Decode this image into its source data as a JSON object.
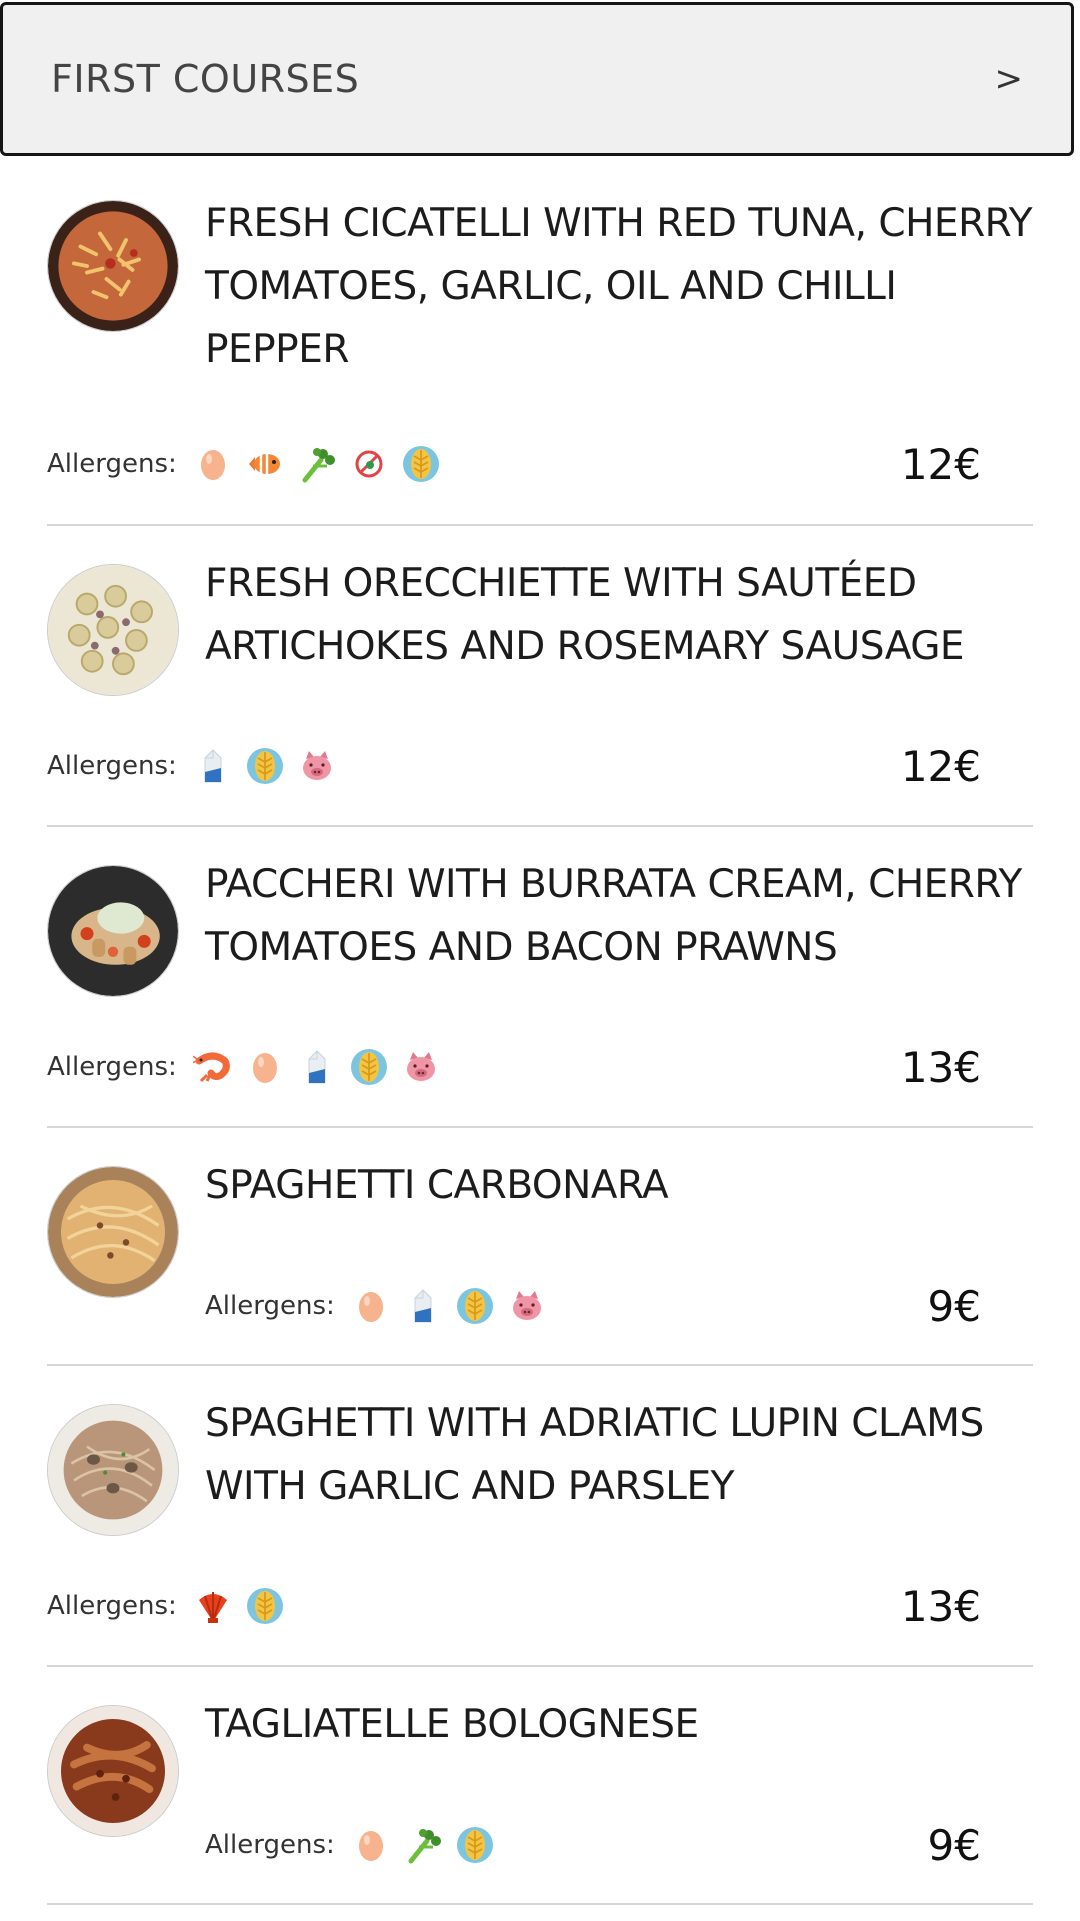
{
  "category": {
    "title": "FIRST COURSES",
    "chevron": ">"
  },
  "allergen_label": "Allergens:",
  "dishes": [
    {
      "name": "FRESH CICATELLI WITH RED TUNA, CHERRY TOMATOES, GARLIC, OIL AND CHILLI PEPPER",
      "price": "12€",
      "allergens": [
        "egg-icon",
        "fish-icon",
        "celery-icon",
        "no-sulfites-icon",
        "gluten-icon"
      ],
      "photo": "pasta-tomato"
    },
    {
      "name": "FRESH ORECCHIETTE WITH SAUTÉED ARTICHOKES AND ROSEMARY SAUSAGE",
      "price": "12€",
      "allergens": [
        "milk-icon",
        "gluten-icon",
        "pork-icon"
      ],
      "photo": "orecchiette"
    },
    {
      "name": "PACCHERI WITH BURRATA CREAM, CHERRY TOMATOES AND BACON PRAWNS",
      "price": "13€",
      "allergens": [
        "shrimp-icon",
        "egg-icon",
        "milk-icon",
        "gluten-icon",
        "pork-icon"
      ],
      "photo": "paccheri"
    },
    {
      "name": "SPAGHETTI CARBONARA",
      "price": "9€",
      "allergens": [
        "egg-icon",
        "milk-icon",
        "gluten-icon",
        "pork-icon"
      ],
      "photo": "carbonara"
    },
    {
      "name": "SPAGHETTI WITH ADRIATIC LUPIN CLAMS WITH GARLIC AND PARSLEY",
      "price": "13€",
      "allergens": [
        "shellfish-icon",
        "gluten-icon"
      ],
      "photo": "clams"
    },
    {
      "name": "TAGLIATELLE BOLOGNESE",
      "price": "9€",
      "allergens": [
        "egg-icon",
        "celery-icon",
        "gluten-icon"
      ],
      "photo": "bolognese"
    }
  ]
}
